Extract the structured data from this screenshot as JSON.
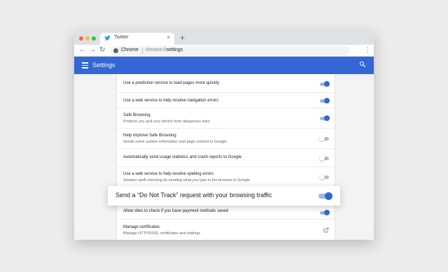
{
  "tab": {
    "title": "Twitter",
    "close": "×",
    "new_tab": "+"
  },
  "toolbar": {
    "back": "←",
    "forward": "→",
    "reload": "↻",
    "site": "Chrome",
    "url_prefix": "chrome://",
    "url_path": "settings",
    "star": "☆",
    "menu": "⋮"
  },
  "header": {
    "title": "Settings"
  },
  "settings": [
    {
      "label": "Use a prediction service to load pages more quickly",
      "sub": "",
      "state": "on"
    },
    {
      "label": "Use a web service to help resolve navigation errors",
      "sub": "",
      "state": "on"
    },
    {
      "label": "Safe Browsing",
      "sub": "Protects you and your device from dangerous sites",
      "state": "on"
    },
    {
      "label": "Help improve Safe Browsing",
      "sub": "Sends some system information and page content to Google",
      "state": "off"
    },
    {
      "label": "Automatically send usage statistics and crash reports to Google",
      "sub": "",
      "state": "off"
    },
    {
      "label": "Use a web service to help resolve spelling errors",
      "sub": "Smarter spell-checking by sending what you type in the browser to Google",
      "state": "off"
    },
    {
      "label": "Allow sites to check if you have payment methods saved",
      "sub": "",
      "state": "on"
    },
    {
      "label": "Manage certificates",
      "sub": "Manage HTTPS/SSL certificates and settings",
      "state": "link"
    }
  ],
  "dnt": {
    "label": "Send a “Do Not Track” request with your browsing traffic",
    "state": "on"
  },
  "colors": {
    "accent": "#3367d6",
    "toggle_track_on": "#9ab7ef"
  }
}
